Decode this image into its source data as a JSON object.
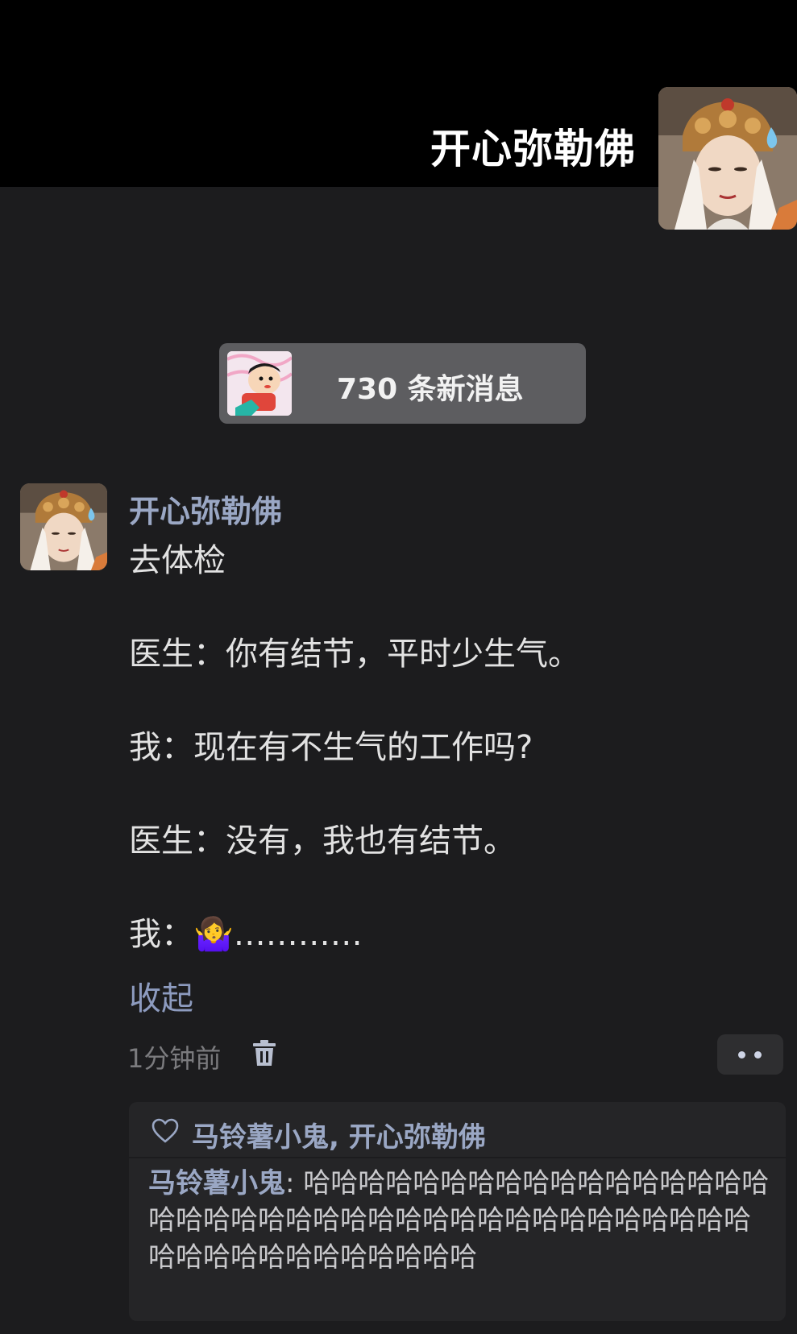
{
  "header": {
    "title": "开心弥勒佛",
    "avatar_icon": "statue-avatar"
  },
  "new_messages": {
    "label": "730 条新消息",
    "avatar_icon": "cartoon-boy-avatar"
  },
  "message": {
    "author": "开心弥勒佛",
    "lines": [
      "去体检",
      "医生：你有结节，平时少生气。",
      "我：现在有不生气的工作吗?",
      "医生：没有，我也有结节。",
      "我：🤷‍♀️…………"
    ],
    "collapse_label": "收起",
    "time": "1分钟前",
    "more_icon": "more-dots-icon",
    "delete_icon": "trash-icon"
  },
  "reactions": {
    "likes": "马铃薯小鬼, 开心弥勒佛",
    "comments": [
      {
        "author": "马铃薯小鬼",
        "separator": ": ",
        "text": "哈哈哈哈哈哈哈哈哈哈哈哈哈哈哈哈哈哈哈哈哈哈哈哈哈哈哈哈哈哈哈哈哈哈哈哈哈哈哈哈哈哈哈哈哈哈哈哈哈哈哈"
      }
    ]
  },
  "colors": {
    "background": "#1c1c1e",
    "header": "#000000",
    "name_accent": "#9aa7c4",
    "pill": "#5d5d60"
  }
}
